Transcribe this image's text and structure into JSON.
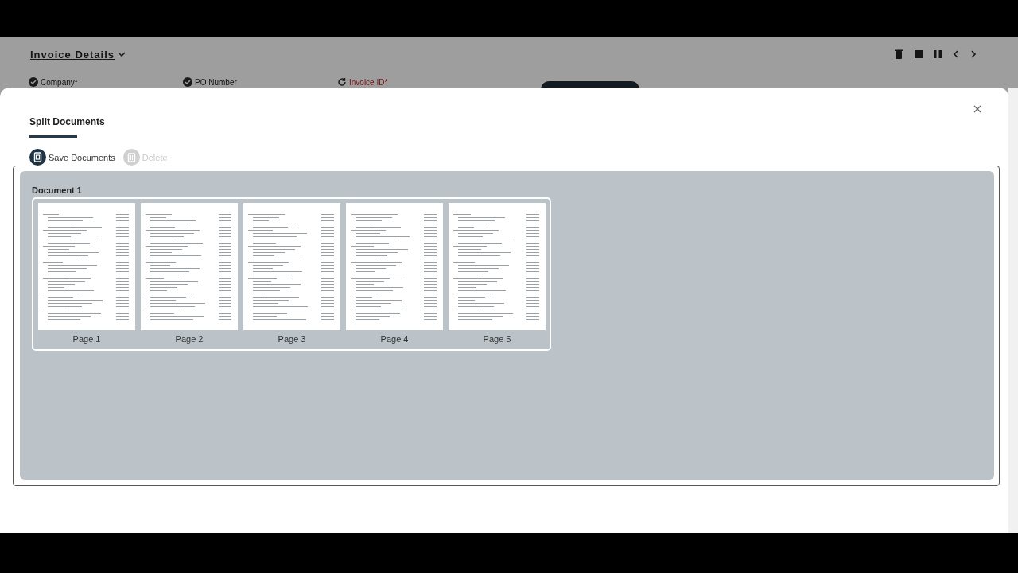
{
  "background_page": {
    "title": "Invoice Details",
    "fields": [
      {
        "label": "Company*",
        "kind": "done"
      },
      {
        "label": "PO Number",
        "kind": "done"
      },
      {
        "label": "Invoice ID*",
        "kind": "pending"
      }
    ]
  },
  "dialog": {
    "title": "Split Documents",
    "actions": [
      {
        "label": "Save Documents",
        "kind": "save",
        "disabled": false
      },
      {
        "label": "Delete",
        "kind": "delete",
        "disabled": true
      }
    ],
    "documents": [
      {
        "title": "Document 1",
        "pages": [
          {
            "label": "Page 1"
          },
          {
            "label": "Page 2"
          },
          {
            "label": "Page 3"
          },
          {
            "label": "Page 4"
          },
          {
            "label": "Page 5"
          }
        ]
      }
    ]
  }
}
